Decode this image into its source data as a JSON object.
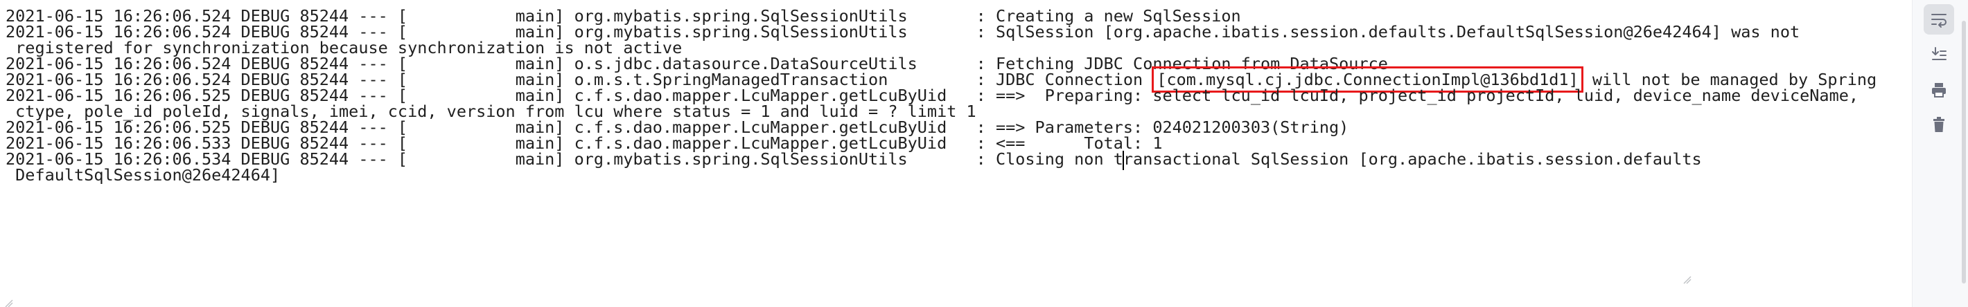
{
  "console": {
    "lines": [
      "2021-06-15 16:26:06.524 DEBUG 85244 --- [           main] org.mybatis.spring.SqlSessionUtils       : Creating a new SqlSession",
      "2021-06-15 16:26:06.524 DEBUG 85244 --- [           main] org.mybatis.spring.SqlSessionUtils       : SqlSession [org.apache.ibatis.session.defaults.DefaultSqlSession@26e42464] was not",
      " registered for synchronization because synchronization is not active",
      "2021-06-15 16:26:06.524 DEBUG 85244 --- [           main] o.s.jdbc.datasource.DataSourceUtils      : Fetching JDBC Connection from DataSource",
      "2021-06-15 16:26:06.525 DEBUG 85244 --- [           main] c.f.s.dao.mapper.LcuMapper.getLcuByUid   : ==>  Preparing: select lcu_id lcuId, project_id projectId, luid, device_name deviceName,",
      " ctype, pole_id poleId, signals, imei, ccid, version from lcu where status = 1 and luid = ? limit 1",
      "2021-06-15 16:26:06.525 DEBUG 85244 --- [           main] c.f.s.dao.mapper.LcuMapper.getLcuByUid   : ==> Parameters: 024021200303(String)",
      "2021-06-15 16:26:06.533 DEBUG 85244 --- [           main] c.f.s.dao.mapper.LcuMapper.getLcuByUid   : <==      Total: 1",
      " DefaultSqlSession@26e42464]"
    ],
    "jdbc_line": {
      "prefix": "2021-06-15 16:26:06.524 DEBUG 85244 --- [           main] o.m.s.t.SpringManagedTransaction         : JDBC Connection ",
      "highlighted": "[com.mysql.cj.jdbc.ConnectionImpl@136bd1d1]",
      "suffix": " will not be managed by Spring"
    },
    "closing_line": {
      "before_caret": "2021-06-15 16:26:06.534 DEBUG 85244 --- [           main] org.mybatis.spring.SqlSessionUtils       : Closing non t",
      "after_caret": "ransactional SqlSession [org.apache.ibatis.session.defaults"
    }
  },
  "toolbar": {
    "soft_wrap_icon": "soft-wrap-icon",
    "scroll_to_end_icon": "scroll-to-end-icon",
    "print_icon": "print-icon",
    "clear_icon": "trash-icon"
  },
  "colors": {
    "text": "#1f1f1f",
    "highlight_border": "#e8191b",
    "toolbar_bg": "#f7f8fa",
    "icon": "#6c707e"
  }
}
